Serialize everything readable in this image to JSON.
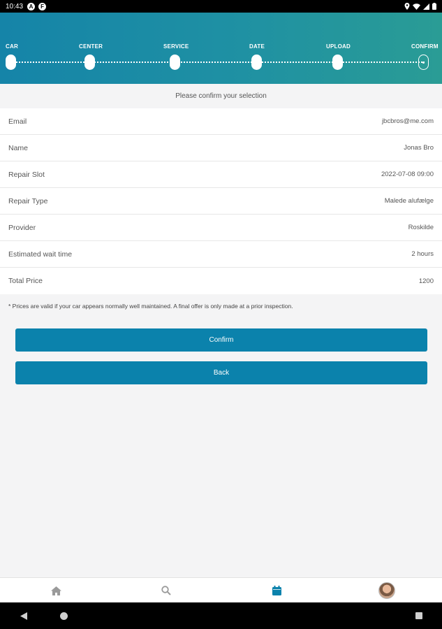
{
  "status_bar": {
    "time": "10:43",
    "badge1": "A",
    "badge2": "F"
  },
  "stepper": {
    "steps": [
      {
        "label": "CAR"
      },
      {
        "label": "CENTER"
      },
      {
        "label": "SERVICE"
      },
      {
        "label": "DATE"
      },
      {
        "label": "UPLOAD"
      },
      {
        "label": "CONFIRM"
      }
    ],
    "current_step": "CONFIRM"
  },
  "main": {
    "subtitle": "Please confirm your selection",
    "details": [
      {
        "label": "Email",
        "value": "jbcbros@me.com"
      },
      {
        "label": "Name",
        "value": "Jonas Bro"
      },
      {
        "label": "Repair Slot",
        "value": "2022-07-08 09:00"
      },
      {
        "label": "Repair Type",
        "value": "Malede alufælge"
      },
      {
        "label": "Provider",
        "value": "Roskilde"
      },
      {
        "label": "Estimated wait time",
        "value": "2 hours"
      },
      {
        "label": "Total Price",
        "value": "1200"
      }
    ],
    "disclaimer": "* Prices are valid if your car appears normally well maintained. A final offer is only made at a prior inspection.",
    "confirm_label": "Confirm",
    "back_label": "Back"
  },
  "tab_bar": {
    "tabs": [
      "home-icon",
      "search-icon",
      "calendar-icon",
      "avatar"
    ],
    "active": "calendar-icon",
    "active_color": "#0b82ac",
    "inactive_color": "#9a9a9a"
  },
  "colors": {
    "accent": "#0b82ac",
    "header_start": "#1584a8",
    "header_end": "#2a9c95"
  }
}
